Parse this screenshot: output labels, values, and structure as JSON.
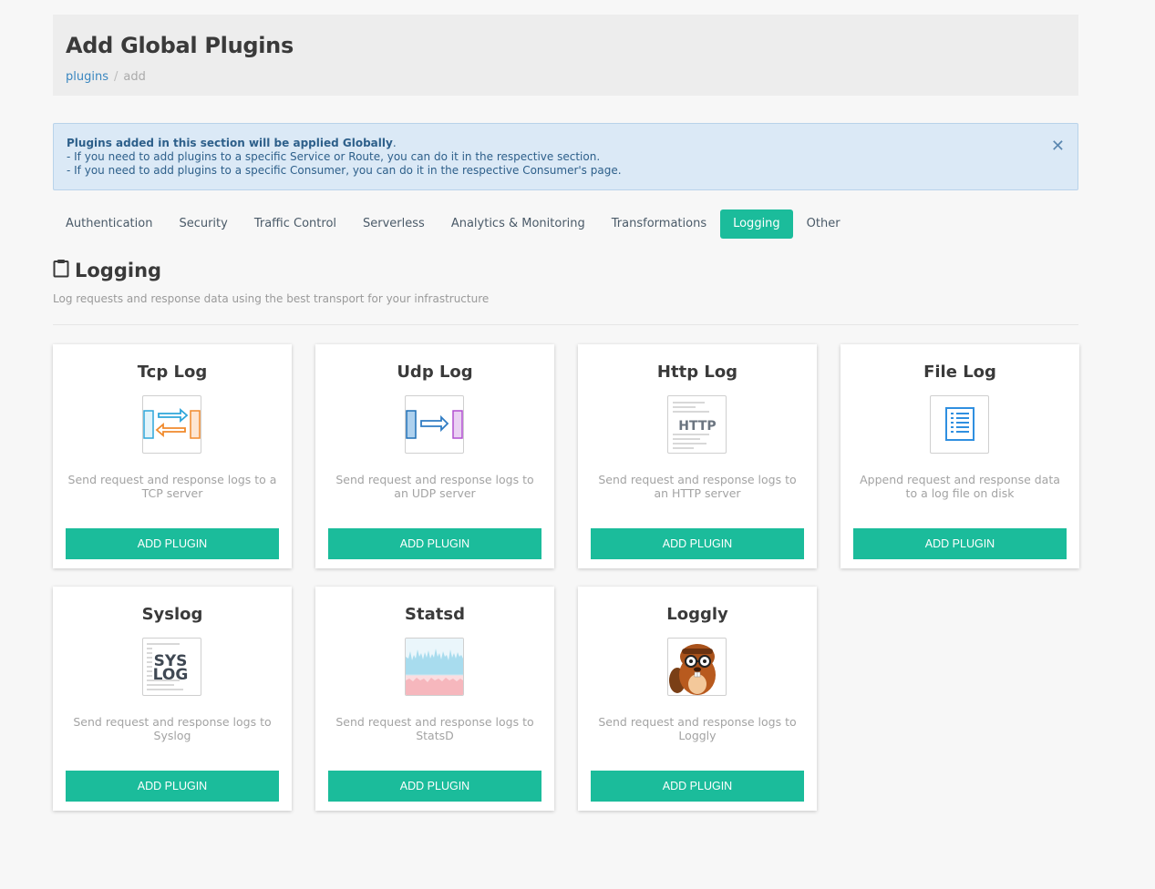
{
  "header": {
    "title": "Add Global Plugins",
    "breadcrumb": {
      "link": "plugins",
      "separator": "/",
      "current": "add"
    }
  },
  "alert": {
    "strong": "Plugins added in this section will be applied Globally",
    "strong_suffix": ".",
    "line1": "- If you need to add plugins to a specific Service or Route, you can do it in the respective section.",
    "line2": "- If you need to add plugins to a specific Consumer, you can do it in the respective Consumer's page.",
    "close": "✕"
  },
  "tabs": [
    {
      "label": "Authentication",
      "active": false
    },
    {
      "label": "Security",
      "active": false
    },
    {
      "label": "Traffic Control",
      "active": false
    },
    {
      "label": "Serverless",
      "active": false
    },
    {
      "label": "Analytics & Monitoring",
      "active": false
    },
    {
      "label": "Transformations",
      "active": false
    },
    {
      "label": "Logging",
      "active": true
    },
    {
      "label": "Other",
      "active": false
    }
  ],
  "section": {
    "icon": "clipboard-icon",
    "title": "Logging",
    "description": "Log requests and response data using the best transport for your infrastructure"
  },
  "plugins": [
    {
      "title": "Tcp Log",
      "icon": "tcp-log-icon",
      "description": "Send request and response logs to a TCP server",
      "button": "ADD PLUGIN"
    },
    {
      "title": "Udp Log",
      "icon": "udp-log-icon",
      "description": "Send request and response logs to an UDP server",
      "button": "ADD PLUGIN"
    },
    {
      "title": "Http Log",
      "icon": "http-log-icon",
      "icon_text": "HTTP",
      "description": "Send request and response logs to an HTTP server",
      "button": "ADD PLUGIN"
    },
    {
      "title": "File Log",
      "icon": "file-log-icon",
      "description": "Append request and response data to a log file on disk",
      "button": "ADD PLUGIN"
    },
    {
      "title": "Syslog",
      "icon": "syslog-icon",
      "icon_text_1": "SYS",
      "icon_text_2": "LOG",
      "description": "Send request and response logs to Syslog",
      "button": "ADD PLUGIN"
    },
    {
      "title": "Statsd",
      "icon": "statsd-icon",
      "description": "Send request and response logs to StatsD",
      "button": "ADD PLUGIN"
    },
    {
      "title": "Loggly",
      "icon": "loggly-icon",
      "description": "Send request and response logs to Loggly",
      "button": "ADD PLUGIN"
    }
  ],
  "colors": {
    "accent": "#1bbc9b",
    "alert_bg": "#dbe9f6",
    "link": "#3a87c0"
  }
}
